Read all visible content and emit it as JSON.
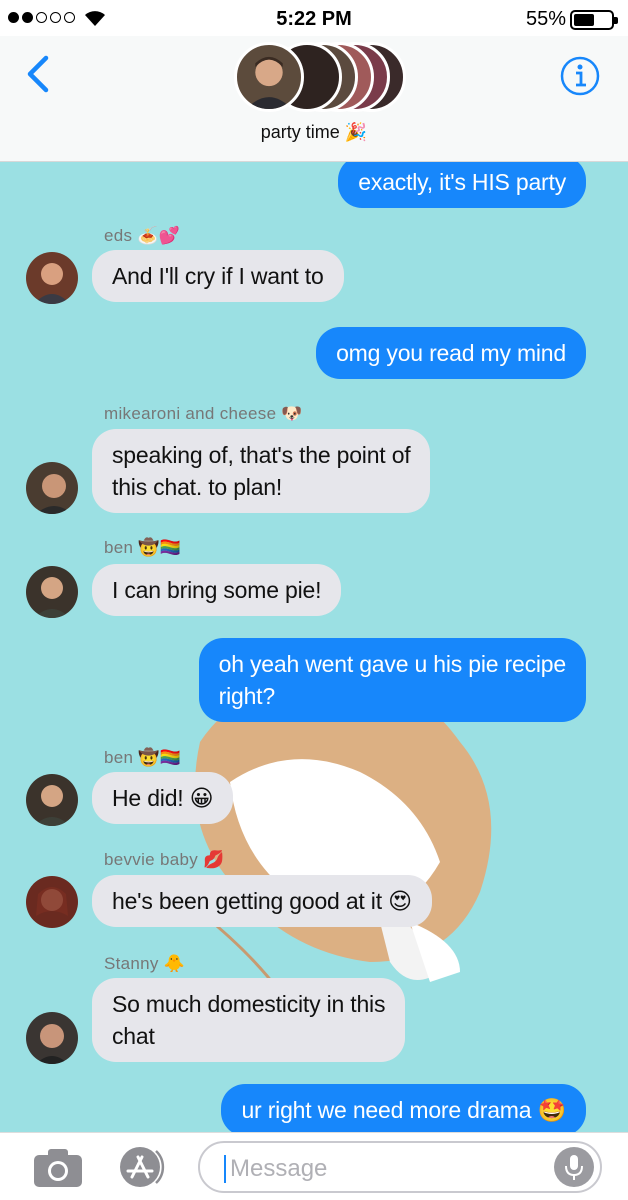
{
  "status": {
    "time": "5:22 PM",
    "battery": "55%",
    "battery_level": 0.55
  },
  "header": {
    "title": "party time 🎉",
    "back_icon": "chevron-left-icon",
    "info_icon": "info-circle-icon"
  },
  "colors": {
    "accent": "#1787fb",
    "chat_background": "#9be0e3",
    "incoming_bubble": "#e6e6eb"
  },
  "messages": [
    {
      "dir": "out",
      "text": "exactly, it's HIS party"
    },
    {
      "dir": "in",
      "sender": "eds 🍝💕",
      "text": "And I'll cry if I want to"
    },
    {
      "dir": "out",
      "text": "omg you read my mind"
    },
    {
      "dir": "in",
      "sender": "mikearoni and cheese 🐶",
      "text_line1": "speaking of, that's the point of",
      "text_line2": "this chat. to plan!"
    },
    {
      "dir": "in",
      "sender": "ben 🤠🏳️‍🌈",
      "text": "I can bring some pie!"
    },
    {
      "dir": "out",
      "text_line1": "oh yeah went gave u his pie recipe",
      "text_line2": "right?"
    },
    {
      "dir": "in",
      "sender": "ben 🤠🏳️‍🌈",
      "text": "He did! 😀"
    },
    {
      "dir": "in",
      "sender": "bevvie baby 💋",
      "text": "he's been getting good at it 😍"
    },
    {
      "dir": "in",
      "sender": "Stanny 🐥",
      "text_line1": "So much domesticity in this",
      "text_line2": "chat"
    },
    {
      "dir": "out",
      "text": "ur right we need more drama 🤩"
    }
  ],
  "composer": {
    "placeholder": "Message",
    "camera_icon": "camera-icon",
    "apps_icon": "app-store-icon",
    "mic_icon": "microphone-icon"
  }
}
